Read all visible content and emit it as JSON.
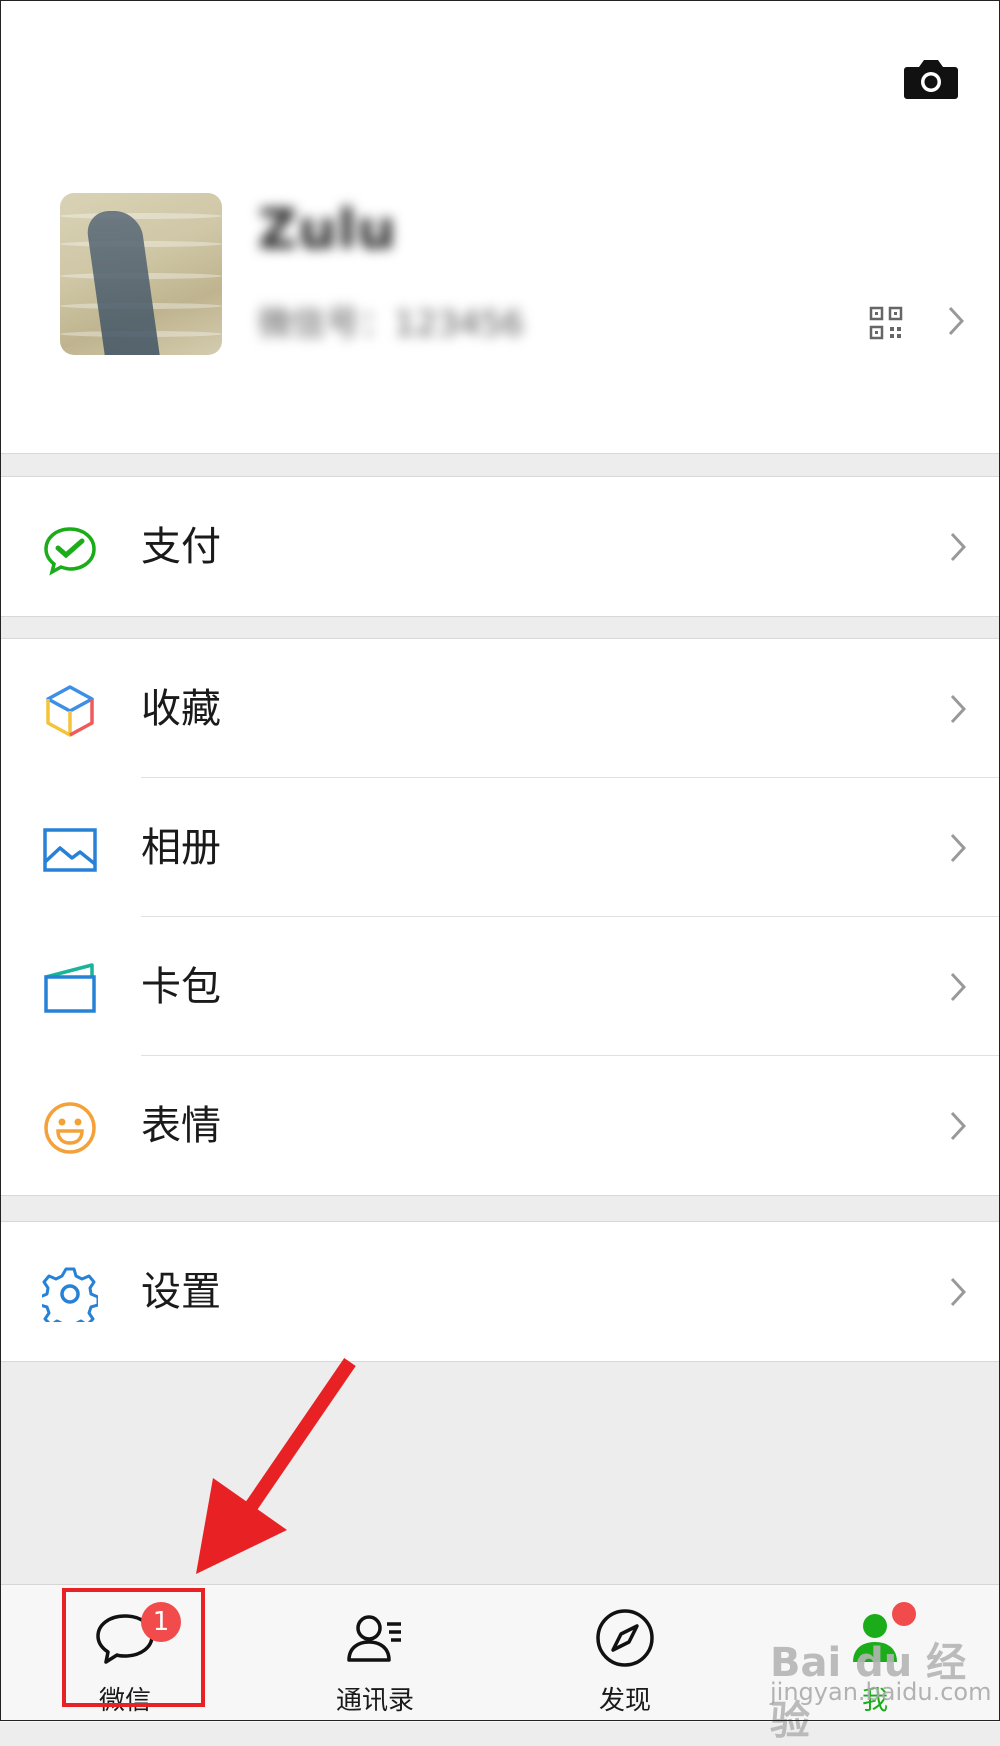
{
  "profile": {
    "nickname": "Zulu",
    "wechat_id": "微信号：123456",
    "camera_icon": "camera-icon",
    "qr_icon": "qr-code-icon"
  },
  "menu": {
    "groups": [
      {
        "items": [
          {
            "label": "支付",
            "icon": "pay-icon",
            "color": "#1aad19"
          }
        ]
      },
      {
        "items": [
          {
            "label": "收藏",
            "icon": "favorites-cube-icon",
            "color": "#3d8ee5"
          },
          {
            "label": "相册",
            "icon": "album-icon",
            "color": "#2782d7"
          },
          {
            "label": "卡包",
            "icon": "card-wallet-icon",
            "color": "#2782d7"
          },
          {
            "label": "表情",
            "icon": "sticker-smile-icon",
            "color": "#f4a13a"
          }
        ]
      },
      {
        "items": [
          {
            "label": "设置",
            "icon": "settings-gear-icon",
            "color": "#2782d7"
          }
        ]
      }
    ]
  },
  "tabbar": {
    "tabs": [
      {
        "label": "微信",
        "icon": "chat-bubble-icon",
        "badge": "1"
      },
      {
        "label": "通讯录",
        "icon": "contacts-icon"
      },
      {
        "label": "发现",
        "icon": "compass-icon"
      },
      {
        "label": "我",
        "icon": "me-person-icon",
        "active": true
      }
    ]
  },
  "colors": {
    "accent_green": "#1aad19",
    "badge_red": "#f14b4b",
    "annotation_red": "#e82224"
  },
  "watermark": {
    "main": "Bai du 经验",
    "sub": "jingyan.baidu.com"
  }
}
